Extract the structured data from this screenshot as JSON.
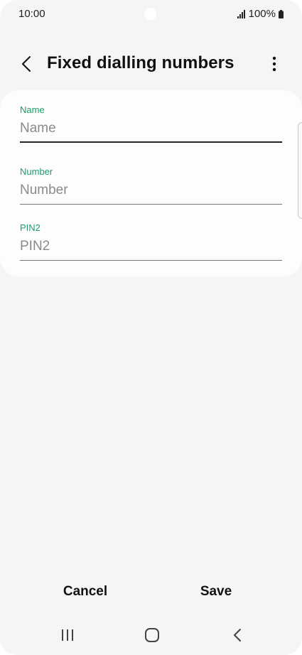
{
  "status_bar": {
    "time": "10:00",
    "battery": "100%"
  },
  "app_bar": {
    "title": "Fixed dialling numbers"
  },
  "form": {
    "fields": [
      {
        "label": "Name",
        "placeholder": "Name"
      },
      {
        "label": "Number",
        "placeholder": "Number"
      },
      {
        "label": "PIN2",
        "placeholder": "PIN2"
      }
    ]
  },
  "actions": {
    "cancel_label": "Cancel",
    "save_label": "Save"
  },
  "icons": {
    "back": "chevron-left-icon",
    "more": "more-vertical-icon",
    "signal": "signal-icon",
    "battery": "battery-icon",
    "nav_recents": "recent-apps-icon",
    "nav_home": "home-icon",
    "nav_back": "back-icon"
  },
  "colors": {
    "accent": "#1a9e6a",
    "background": "#f5f5f5",
    "card": "#fdfdfd"
  }
}
